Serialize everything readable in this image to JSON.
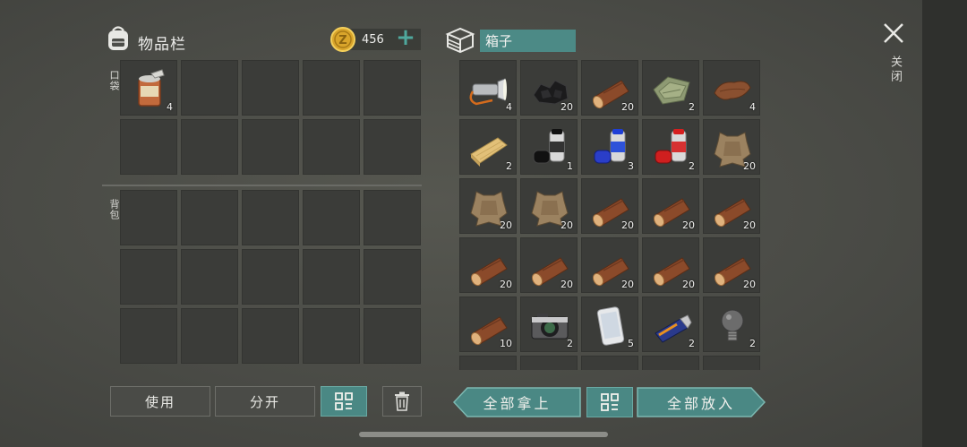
{
  "inventory": {
    "title": "物品栏",
    "coins": "456",
    "coin_add": "+",
    "pocket_label": "口袋",
    "backpack_label": "背包",
    "pocket_items": [
      {
        "icon": "canned-food-icon",
        "qty": "4"
      },
      {
        "icon": "empty",
        "qty": ""
      },
      {
        "icon": "empty",
        "qty": ""
      },
      {
        "icon": "empty",
        "qty": ""
      },
      {
        "icon": "empty",
        "qty": ""
      },
      {
        "icon": "empty",
        "qty": ""
      },
      {
        "icon": "empty",
        "qty": ""
      },
      {
        "icon": "empty",
        "qty": ""
      },
      {
        "icon": "empty",
        "qty": ""
      },
      {
        "icon": "empty",
        "qty": ""
      }
    ],
    "backpack_slots": 15
  },
  "box": {
    "name": "箱子",
    "items": [
      {
        "icon": "flashlight-icon",
        "qty": "4"
      },
      {
        "icon": "coal-icon",
        "qty": "20"
      },
      {
        "icon": "log-icon",
        "qty": "20"
      },
      {
        "icon": "cloth-icon",
        "qty": "2"
      },
      {
        "icon": "leather-icon",
        "qty": "4"
      },
      {
        "icon": "plank-icon",
        "qty": "2"
      },
      {
        "icon": "black-paint-icon",
        "qty": "1"
      },
      {
        "icon": "blue-paint-icon",
        "qty": "3"
      },
      {
        "icon": "red-paint-icon",
        "qty": "2"
      },
      {
        "icon": "hide-icon",
        "qty": "20"
      },
      {
        "icon": "hide-icon",
        "qty": "20"
      },
      {
        "icon": "hide-icon",
        "qty": "20"
      },
      {
        "icon": "log-icon",
        "qty": "20"
      },
      {
        "icon": "log-icon",
        "qty": "20"
      },
      {
        "icon": "log-icon",
        "qty": "20"
      },
      {
        "icon": "log-icon",
        "qty": "20"
      },
      {
        "icon": "log-icon",
        "qty": "20"
      },
      {
        "icon": "log-icon",
        "qty": "20"
      },
      {
        "icon": "log-icon",
        "qty": "20"
      },
      {
        "icon": "log-icon",
        "qty": "20"
      },
      {
        "icon": "log-icon",
        "qty": "10"
      },
      {
        "icon": "camera-icon",
        "qty": "2"
      },
      {
        "icon": "smartphone-icon",
        "qty": "5"
      },
      {
        "icon": "usb-drive-icon",
        "qty": "2"
      },
      {
        "icon": "light-bulb-icon",
        "qty": "2"
      }
    ]
  },
  "close_label": "关闭",
  "buttons": {
    "use": "使用",
    "split": "分开",
    "take_all": "全部拿上",
    "put_all": "全部放入"
  },
  "colors": {
    "accent_teal": "#4a8884",
    "coin_gold": "#d9a52b",
    "slot_bg": "#3b3c39"
  }
}
